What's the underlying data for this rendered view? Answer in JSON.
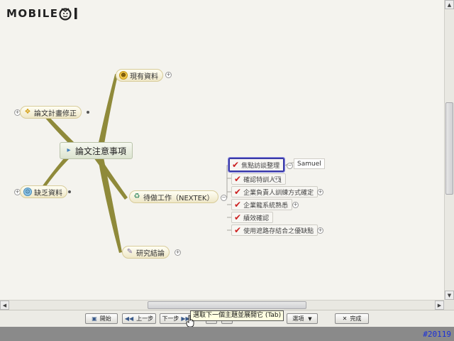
{
  "logo": {
    "text": "MOBILE"
  },
  "mindmap": {
    "central": "論文注意事項",
    "branches": {
      "existing": "現有資料",
      "revision": "論文計畫修正",
      "missing": "缺乏資料",
      "pending": "待做工作（NEXTEK）",
      "conclusion": "研究結論"
    },
    "subtasks": [
      "焦點訪談整理",
      "確認特訓人員",
      "企業負責人訓練方式確定",
      "企業龍系統熟悉",
      "績效確認",
      "使用遮路存結合之優缺點"
    ],
    "callout": "Samuel"
  },
  "toolbar": {
    "start": "開始",
    "prev": "上一步",
    "next": "下一步",
    "options": "選項",
    "finish": "完成",
    "tooltip": "選取下一個主題並展開它 (Tab)"
  },
  "watermark": "#20119",
  "colors": {
    "branch_line": "#8f8a3a",
    "selection": "#3a3aa8",
    "check": "#cc2020",
    "watermark": "#1a2fd8"
  },
  "icons": {
    "existing": "smiley-icon",
    "revision": "lightbulb-icon",
    "central": "megaphone-icon",
    "missing": "sad-face-icon",
    "pending": "recycle-icon",
    "conclusion": "pencil-icon",
    "subtask": "checkmark-icon"
  }
}
